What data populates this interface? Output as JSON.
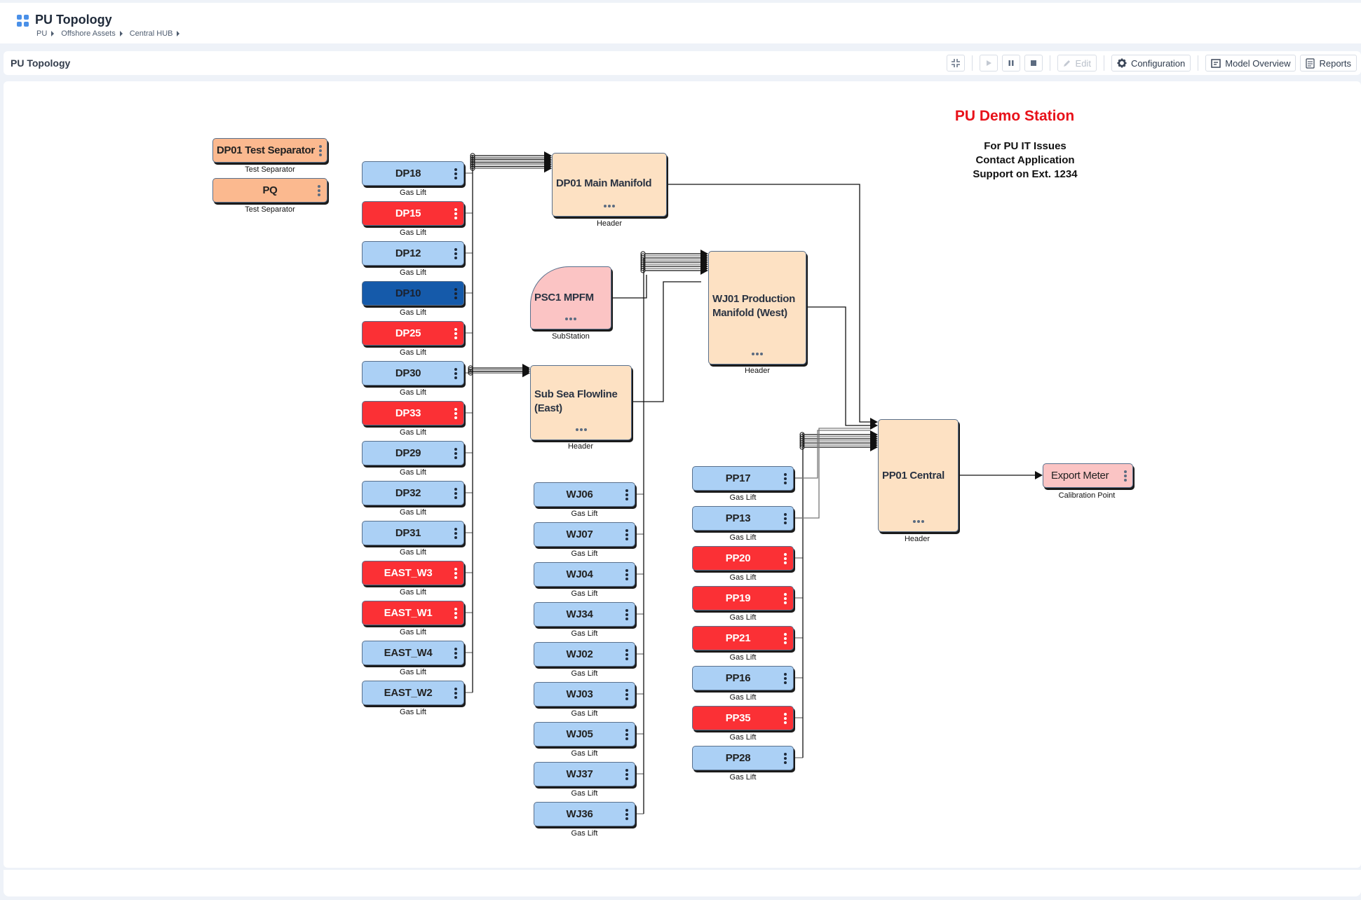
{
  "header": {
    "app_title": "PU Topology",
    "breadcrumb": [
      "PU",
      "Offshore Assets",
      "Central HUB"
    ]
  },
  "subheader": {
    "title": "PU Topology",
    "toolbar": {
      "collapse_icon": "collapse-icon",
      "play_icon": "play-icon",
      "pause_icon": "pause-icon",
      "stop_icon": "stop-icon",
      "edit_label": "Edit",
      "configuration_label": "Configuration",
      "model_overview_label": "Model Overview",
      "reports_label": "Reports"
    }
  },
  "station": {
    "title": "PU Demo Station",
    "note": [
      "For PU IT Issues",
      "Contact Application",
      "Support on Ext. 1234"
    ]
  },
  "colors": {
    "normal": "#abd0f5",
    "alarm": "#fb3035",
    "selected": "#155aaa",
    "header": "#fde1c3",
    "separator": "#fbb98f",
    "meter": "#fbc4c4",
    "title": "#e8121a"
  },
  "separators": [
    {
      "name": "DP01 Test Separator",
      "type": "Test Separator"
    },
    {
      "name": "PQ",
      "type": "Test Separator"
    }
  ],
  "dp_wells": [
    {
      "name": "DP18",
      "type": "Gas Lift",
      "status": "normal"
    },
    {
      "name": "DP15",
      "type": "Gas Lift",
      "status": "alarm"
    },
    {
      "name": "DP12",
      "type": "Gas Lift",
      "status": "normal"
    },
    {
      "name": "DP10",
      "type": "Gas Lift",
      "status": "selected"
    },
    {
      "name": "DP25",
      "type": "Gas Lift",
      "status": "alarm"
    },
    {
      "name": "DP30",
      "type": "Gas Lift",
      "status": "normal"
    },
    {
      "name": "DP33",
      "type": "Gas Lift",
      "status": "alarm"
    },
    {
      "name": "DP29",
      "type": "Gas Lift",
      "status": "normal"
    },
    {
      "name": "DP32",
      "type": "Gas Lift",
      "status": "normal"
    },
    {
      "name": "DP31",
      "type": "Gas Lift",
      "status": "normal"
    },
    {
      "name": "EAST_W3",
      "type": "Gas Lift",
      "status": "alarm"
    },
    {
      "name": "EAST_W1",
      "type": "Gas Lift",
      "status": "alarm"
    },
    {
      "name": "EAST_W4",
      "type": "Gas Lift",
      "status": "normal"
    },
    {
      "name": "EAST_W2",
      "type": "Gas Lift",
      "status": "normal"
    }
  ],
  "wj_wells": [
    {
      "name": "WJ06",
      "type": "Gas Lift",
      "status": "normal"
    },
    {
      "name": "WJ07",
      "type": "Gas Lift",
      "status": "normal"
    },
    {
      "name": "WJ04",
      "type": "Gas Lift",
      "status": "normal"
    },
    {
      "name": "WJ34",
      "type": "Gas Lift",
      "status": "normal"
    },
    {
      "name": "WJ02",
      "type": "Gas Lift",
      "status": "normal"
    },
    {
      "name": "WJ03",
      "type": "Gas Lift",
      "status": "normal"
    },
    {
      "name": "WJ05",
      "type": "Gas Lift",
      "status": "normal"
    },
    {
      "name": "WJ37",
      "type": "Gas Lift",
      "status": "normal"
    },
    {
      "name": "WJ36",
      "type": "Gas Lift",
      "status": "normal"
    }
  ],
  "pp_wells": [
    {
      "name": "PP17",
      "type": "Gas Lift",
      "status": "normal"
    },
    {
      "name": "PP13",
      "type": "Gas Lift",
      "status": "normal"
    },
    {
      "name": "PP20",
      "type": "Gas Lift",
      "status": "alarm"
    },
    {
      "name": "PP19",
      "type": "Gas Lift",
      "status": "alarm"
    },
    {
      "name": "PP21",
      "type": "Gas Lift",
      "status": "alarm"
    },
    {
      "name": "PP16",
      "type": "Gas Lift",
      "status": "normal"
    },
    {
      "name": "PP35",
      "type": "Gas Lift",
      "status": "alarm"
    },
    {
      "name": "PP28",
      "type": "Gas Lift",
      "status": "normal"
    }
  ],
  "headers": {
    "dp01_main": {
      "name": "DP01 Main Manifold",
      "type": "Header"
    },
    "psc1": {
      "name": "PSC1 MPFM",
      "type": "SubStation"
    },
    "wj01": {
      "name": "WJ01 Production Manifold (West)",
      "type": "Header"
    },
    "subsea": {
      "name": "Sub Sea Flowline (East)",
      "type": "Header"
    },
    "pp01": {
      "name": "PP01 Central",
      "type": "Header"
    }
  },
  "export_meter": {
    "name": "Export Meter",
    "type": "Calibration Point"
  }
}
